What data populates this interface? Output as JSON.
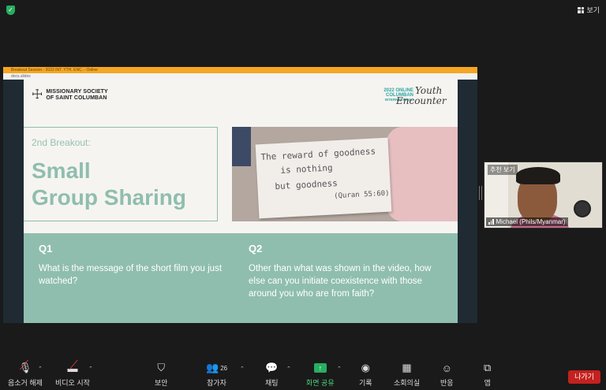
{
  "top": {
    "view_label": "보기"
  },
  "share_window": {
    "title_bar": "Breakout Session - 2022 INT. YTH. ENC. - Online",
    "url_bar": "docs.slides"
  },
  "slide": {
    "org_line1": "MISSIONARY SOCIETY",
    "org_line2": "OF SAINT COLUMBAN",
    "event_small_1": "2022 ONLINE",
    "event_small_2": "COLUMBAN",
    "event_small_3": "INTERNATIONAL",
    "event_script_1": "Youth",
    "event_script_2": "Encounter",
    "subtitle": "2nd Breakout:",
    "title_1": "Small",
    "title_2": "Group Sharing",
    "note_lines": [
      "The reward of goodness",
      "is nothing",
      "but goodness",
      "(Quran 55:60)"
    ],
    "q1_label": "Q1",
    "q1_text": "What is the message of the short film you just watched?",
    "q2_label": "Q2",
    "q2_text": "Other than what was shown in the video, how else can you initiate coexistence with those around you who are from faith?"
  },
  "participant": {
    "pin_label": "추천 보기",
    "name": "Michael (Phils/Myanmar)"
  },
  "toolbar": {
    "mute": "음소거 해제",
    "video": "비디오 시작",
    "security": "보안",
    "participants": "참가자",
    "participants_count": "26",
    "chat": "채팅",
    "share": "화면 공유",
    "record": "기록",
    "breakout": "소회의실",
    "reactions": "반응",
    "apps": "앱",
    "leave": "나가기"
  },
  "colors": {
    "accent": "#8fbeae",
    "share_green": "#27ae60",
    "leave_red": "#c4211f"
  }
}
